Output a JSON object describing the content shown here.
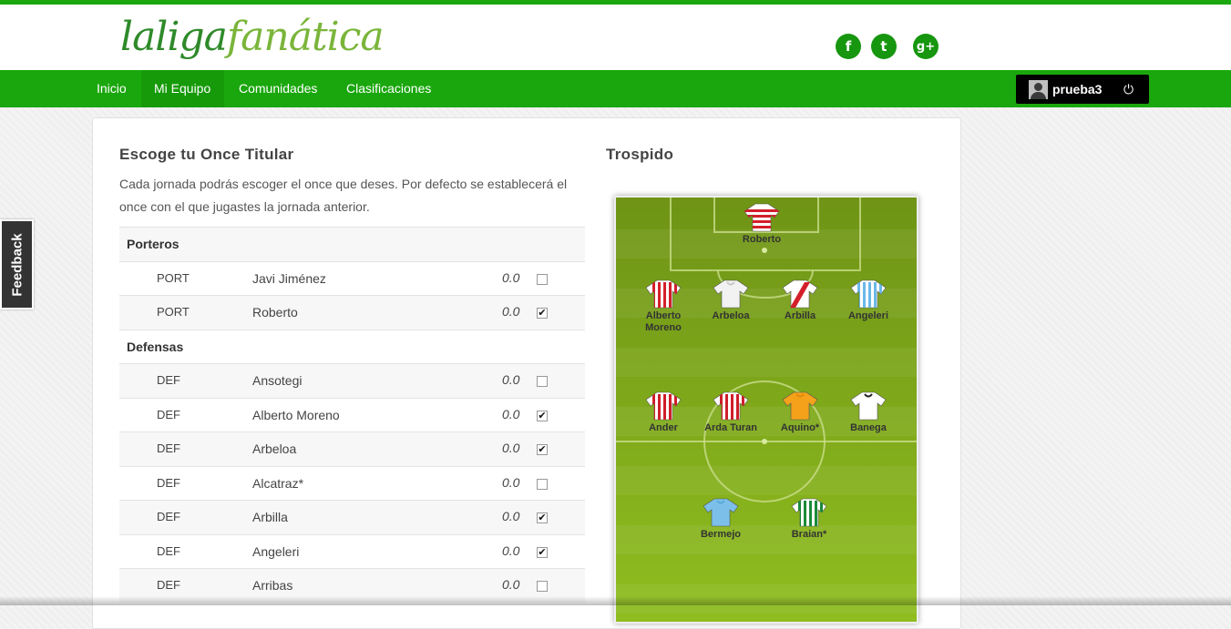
{
  "brand": {
    "logo_main": "laliga",
    "logo_alt": "fanática"
  },
  "social": [
    {
      "icon": "facebook-icon",
      "glyph": "f"
    },
    {
      "icon": "twitter-icon",
      "glyph": "t"
    },
    {
      "icon": "google-plus-icon",
      "glyph": "g+"
    }
  ],
  "nav": {
    "items": [
      "Inicio",
      "Mi Equipo",
      "Comunidades",
      "Clasificaciones"
    ],
    "active": "Mi Equipo"
  },
  "user": {
    "name": "prueba3",
    "logout_glyph": "⏻"
  },
  "feedback": {
    "label": "Feedback"
  },
  "lineup": {
    "title": "Escoge tu Once Titular",
    "description": "Cada jornada podrás escoger el once que deses. Por defecto se establecerá el once con el que jugastes la jornada anterior.",
    "groups": [
      {
        "name": "Porteros",
        "players": [
          {
            "pos": "PORT",
            "name": "Javi Jiménez",
            "points": "0.0",
            "selected": false
          },
          {
            "pos": "PORT",
            "name": "Roberto",
            "points": "0.0",
            "selected": true
          }
        ]
      },
      {
        "name": "Defensas",
        "players": [
          {
            "pos": "DEF",
            "name": "Ansotegi",
            "points": "0.0",
            "selected": false
          },
          {
            "pos": "DEF",
            "name": "Alberto Moreno",
            "points": "0.0",
            "selected": true
          },
          {
            "pos": "DEF",
            "name": "Arbeloa",
            "points": "0.0",
            "selected": true
          },
          {
            "pos": "DEF",
            "name": "Alcatraz*",
            "points": "0.0",
            "selected": false
          },
          {
            "pos": "DEF",
            "name": "Arbilla",
            "points": "0.0",
            "selected": true
          },
          {
            "pos": "DEF",
            "name": "Angeleri",
            "points": "0.0",
            "selected": true
          },
          {
            "pos": "DEF",
            "name": "Arribas",
            "points": "0.0",
            "selected": false
          }
        ]
      }
    ]
  },
  "team": {
    "name": "Trospido",
    "pitch_players": [
      {
        "name": "Roberto",
        "line": "goalkeeper",
        "kit": "red-stripes"
      },
      {
        "name": "Alberto Moreno",
        "line": "defense",
        "kit": "white-red"
      },
      {
        "name": "Arbeloa",
        "line": "defense",
        "kit": "white"
      },
      {
        "name": "Arbilla",
        "line": "defense",
        "kit": "white-red-sash"
      },
      {
        "name": "Angeleri",
        "line": "defense",
        "kit": "sky-stripes"
      },
      {
        "name": "Ander",
        "line": "midfield",
        "kit": "red-white-stripes"
      },
      {
        "name": "Arda Turan",
        "line": "midfield",
        "kit": "red-white-stripes"
      },
      {
        "name": "Aquino*",
        "line": "midfield",
        "kit": "orange"
      },
      {
        "name": "Banega",
        "line": "midfield",
        "kit": "white-black"
      },
      {
        "name": "Bermejo",
        "line": "forward",
        "kit": "sky"
      },
      {
        "name": "Braian*",
        "line": "forward",
        "kit": "green-white-stripes"
      }
    ]
  },
  "colors": {
    "brand_green": "#1aa70d",
    "pitch_dark": "#7da61a",
    "pitch_light": "#8cb81f"
  }
}
